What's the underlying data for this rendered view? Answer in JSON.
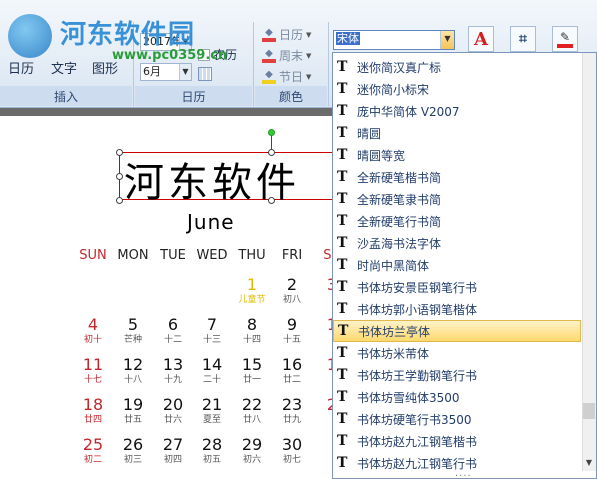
{
  "watermark": {
    "title": "河东软件园",
    "url": "www.pc0359.cn"
  },
  "ribbon": {
    "insert_group": {
      "label": "插入",
      "buttons": [
        "日历",
        "文字",
        "图形"
      ]
    },
    "calendar_group": {
      "label": "日历",
      "year": "2017年",
      "month": "6月",
      "lunar_checkbox": "农历"
    },
    "color_group": {
      "label": "颜色",
      "buttons": [
        "日历",
        "周末",
        "节日"
      ]
    },
    "font_combo": {
      "value": "宋体"
    }
  },
  "document": {
    "title": "河东软件",
    "month": "June",
    "weekdays": [
      "SUN",
      "MON",
      "TUE",
      "WED",
      "THU",
      "FRI",
      "SA"
    ],
    "weeks": [
      [
        {
          "n": "",
          "l": ""
        },
        {
          "n": "",
          "l": ""
        },
        {
          "n": "",
          "l": ""
        },
        {
          "n": "",
          "l": ""
        },
        {
          "n": "1",
          "l": "儿童节"
        },
        {
          "n": "2",
          "l": "初八"
        },
        {
          "n": "3",
          "l": ""
        }
      ],
      [
        {
          "n": "4",
          "l": "初十"
        },
        {
          "n": "5",
          "l": "芒种"
        },
        {
          "n": "6",
          "l": "十二"
        },
        {
          "n": "7",
          "l": "十三"
        },
        {
          "n": "8",
          "l": "十四"
        },
        {
          "n": "9",
          "l": "十五"
        },
        {
          "n": "1",
          "l": ""
        }
      ],
      [
        {
          "n": "11",
          "l": "十七"
        },
        {
          "n": "12",
          "l": "十八"
        },
        {
          "n": "13",
          "l": "十九"
        },
        {
          "n": "14",
          "l": "二十"
        },
        {
          "n": "15",
          "l": "廿一"
        },
        {
          "n": "16",
          "l": "廿二"
        },
        {
          "n": "1",
          "l": ""
        }
      ],
      [
        {
          "n": "18",
          "l": "廿四"
        },
        {
          "n": "19",
          "l": "廿五"
        },
        {
          "n": "20",
          "l": "廿六"
        },
        {
          "n": "21",
          "l": "夏至"
        },
        {
          "n": "22",
          "l": "廿八"
        },
        {
          "n": "23",
          "l": "廿九"
        },
        {
          "n": "2",
          "l": ""
        }
      ],
      [
        {
          "n": "25",
          "l": "初二"
        },
        {
          "n": "26",
          "l": "初三"
        },
        {
          "n": "27",
          "l": "初四"
        },
        {
          "n": "28",
          "l": "初五"
        },
        {
          "n": "29",
          "l": "初六"
        },
        {
          "n": "30",
          "l": "初七"
        },
        {
          "n": "",
          "l": ""
        }
      ]
    ]
  },
  "font_list": {
    "icon_glyph": "T",
    "selected_index": 12,
    "items": [
      "迷你简汉真广标",
      "迷你简小标宋",
      "庞中华简体 V2007",
      "晴圆",
      "晴圆等宽",
      "全新硬笔楷书简",
      "全新硬笔隶书简",
      "全新硬笔行书简",
      "沙孟海书法字体",
      "时尚中黑简体",
      "书体坊安景臣钢笔行书",
      "书体坊郭小语钢笔楷体",
      "书体坊兰亭体",
      "书体坊米芾体",
      "书体坊王学勤钢笔行书",
      "书体坊雪纯体3500",
      "书体坊硬笔行书3500",
      "书体坊赵九江钢笔楷书",
      "书体坊赵九江钢笔行书"
    ]
  },
  "colors": {
    "accent": "#2a8ad6",
    "weekend_red": "#c0282e",
    "festival_yellow": "#e3b800",
    "selection": "#ffd970"
  }
}
